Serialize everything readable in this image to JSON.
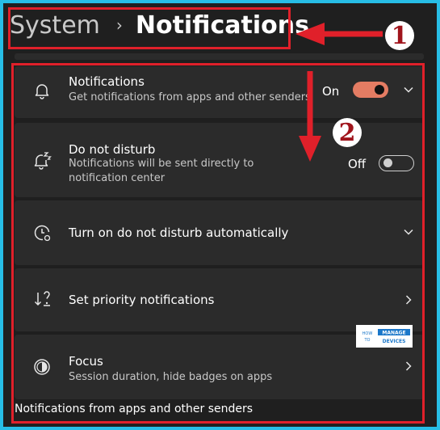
{
  "breadcrumb": {
    "parent": "System",
    "separator": "›",
    "current": "Notifications"
  },
  "cards": [
    {
      "id": "notifications",
      "title": "Notifications",
      "description": "Get notifications from apps and other senders",
      "toggle_label": "On",
      "toggle_state": "on",
      "icon": "bell-icon",
      "trailing": "chevron-down"
    },
    {
      "id": "do-not-disturb",
      "title": "Do not disturb",
      "description": "Notifications will be sent directly to notification center",
      "toggle_label": "Off",
      "toggle_state": "off",
      "icon": "bell-zz-icon"
    },
    {
      "id": "dnd-auto",
      "title": "Turn on do not disturb automatically",
      "icon": "clock-icon",
      "trailing": "chevron-down"
    },
    {
      "id": "priority",
      "title": "Set priority notifications",
      "icon": "priority-icon",
      "trailing": "chevron-right"
    },
    {
      "id": "focus",
      "title": "Focus",
      "description": "Session duration, hide badges on apps",
      "icon": "focus-icon",
      "trailing": "chevron-right"
    }
  ],
  "section_heading": "Notifications from apps and other senders",
  "annotations": {
    "one": "1",
    "two": "2"
  },
  "logo": {
    "text_how_to": "HOW TO",
    "text_manage": "MANAGE",
    "text_devices": "DEVICES"
  },
  "colors": {
    "accent": "#e47c63",
    "annotation": "#e0202a",
    "frame": "#27bde6"
  }
}
